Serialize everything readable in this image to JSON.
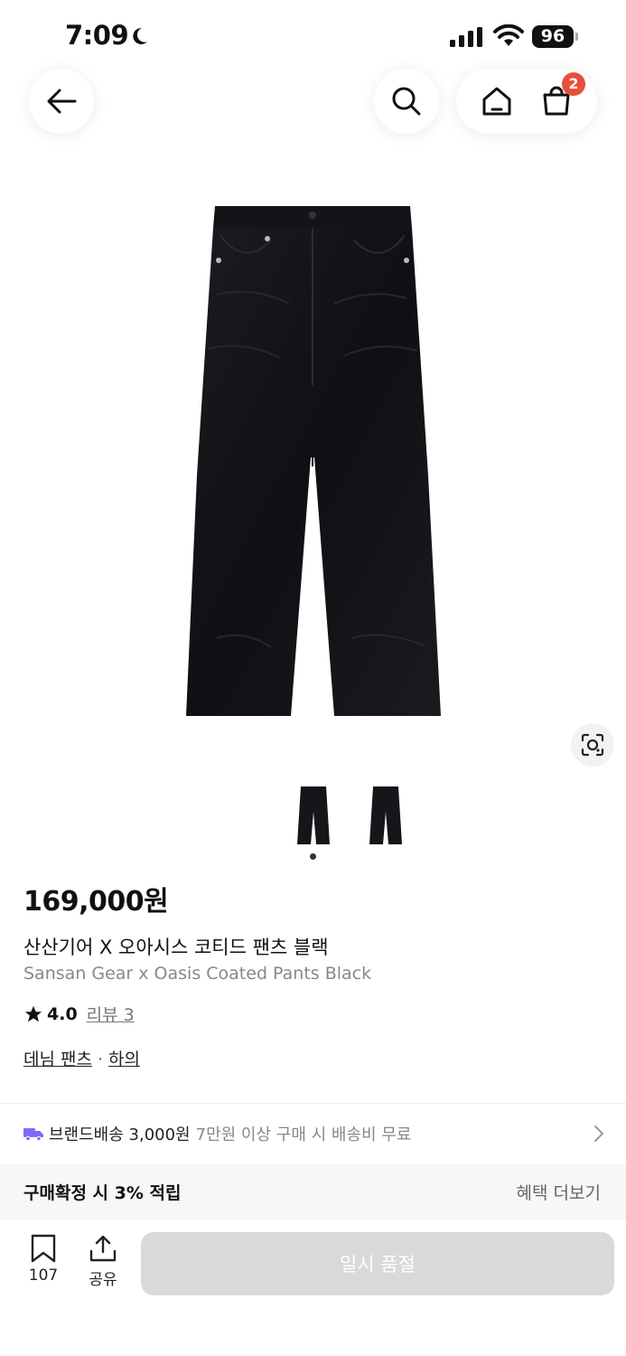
{
  "status_bar": {
    "time": "7:09",
    "battery": "96"
  },
  "nav": {
    "cart_count": "2"
  },
  "product": {
    "price": "169,000원",
    "name_ko": "산산기어 X 오아시스 코티드 팬츠 블랙",
    "name_en": "Sansan Gear x Oasis Coated Pants Black",
    "rating": "4.0",
    "review_label": "리뷰 3",
    "categories": [
      "데님 팬츠",
      "하의"
    ],
    "category_separator": "·",
    "image_subject": "black-jeans"
  },
  "shipping": {
    "label": "브랜드배송 3,000원",
    "condition": "7만원 이상 구매 시 배송비 무료"
  },
  "benefit": {
    "title": "구매확정 시 3% 적립",
    "more": "혜택 더보기"
  },
  "bottom_bar": {
    "bookmark_count": "107",
    "share_label": "공유",
    "buy_label": "일시 품절"
  },
  "colors": {
    "badge": "#e84e3c",
    "shipping_icon": "#7b6cf6",
    "disabled_button": "#d9d9d9"
  }
}
